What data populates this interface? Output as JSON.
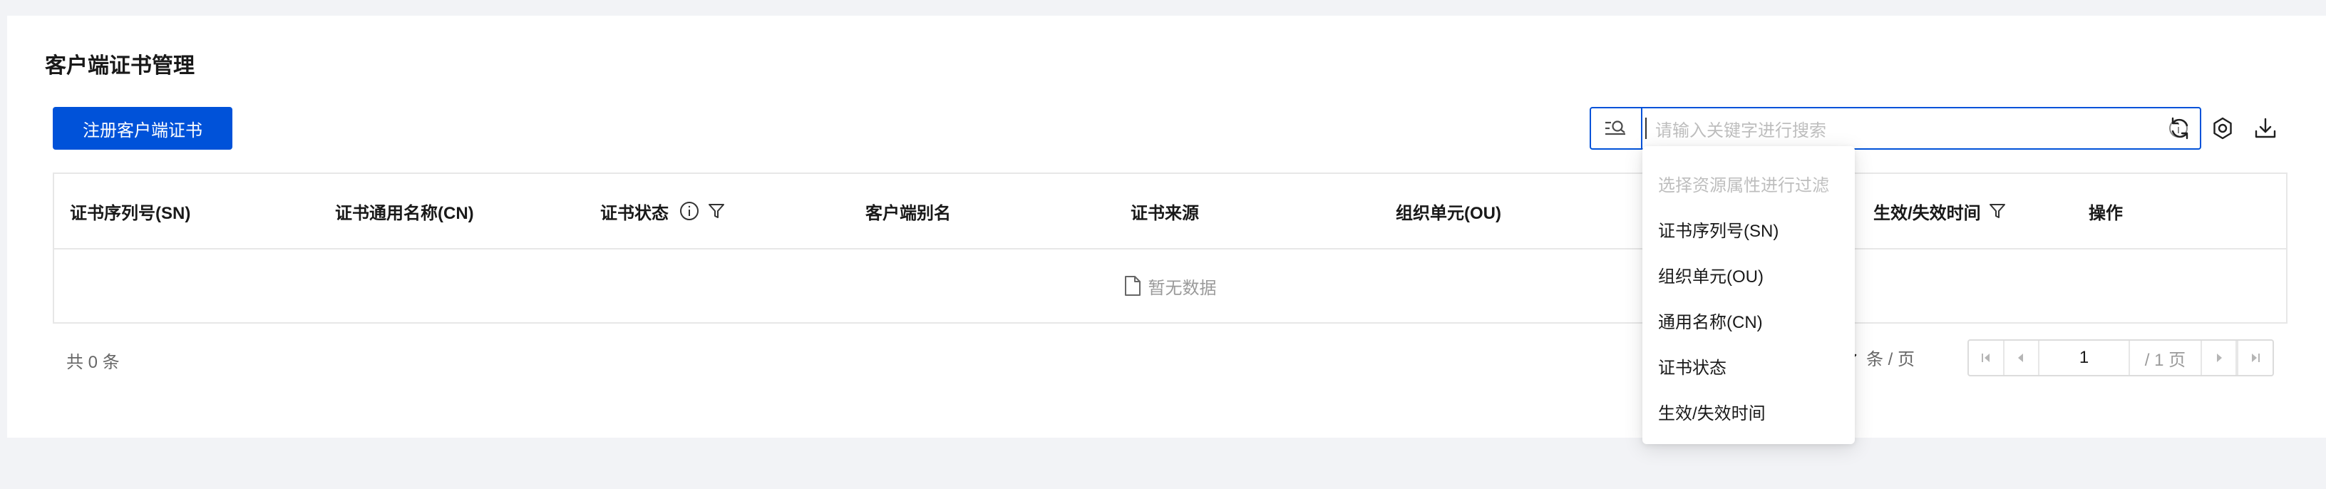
{
  "page": {
    "title": "客户端证书管理",
    "register_button": "注册客户端证书"
  },
  "search": {
    "placeholder": "请输入关键字进行搜索",
    "icons": [
      "filter-search-icon",
      "info-icon"
    ]
  },
  "toolbar": {
    "icons": [
      "refresh-icon",
      "settings-icon",
      "download-icon"
    ]
  },
  "table": {
    "columns": [
      {
        "label": "证书序列号(SN)"
      },
      {
        "label": "证书通用名称(CN)"
      },
      {
        "label": "证书状态",
        "icons": [
          "info-icon",
          "filter-icon"
        ]
      },
      {
        "label": "客户端别名"
      },
      {
        "label": "证书来源"
      },
      {
        "label": "组织单元(OU)"
      },
      {
        "label": "生效/失效时间",
        "icons": [
          "filter-icon"
        ]
      },
      {
        "label": "操作"
      }
    ],
    "empty_text": "暂无数据"
  },
  "footer": {
    "total": "共 0 条",
    "page_size_suffix": "条 / 页",
    "current_page": "1",
    "total_pages": "/ 1 页"
  },
  "dropdown": {
    "hint": "选择资源属性进行过滤",
    "items": [
      "证书序列号(SN)",
      "组织单元(OU)",
      "通用名称(CN)",
      "证书状态",
      "生效/失效时间"
    ]
  },
  "colors": {
    "primary": "#0052d9",
    "background": "#f2f3f6",
    "border": "#e7e7e7"
  }
}
